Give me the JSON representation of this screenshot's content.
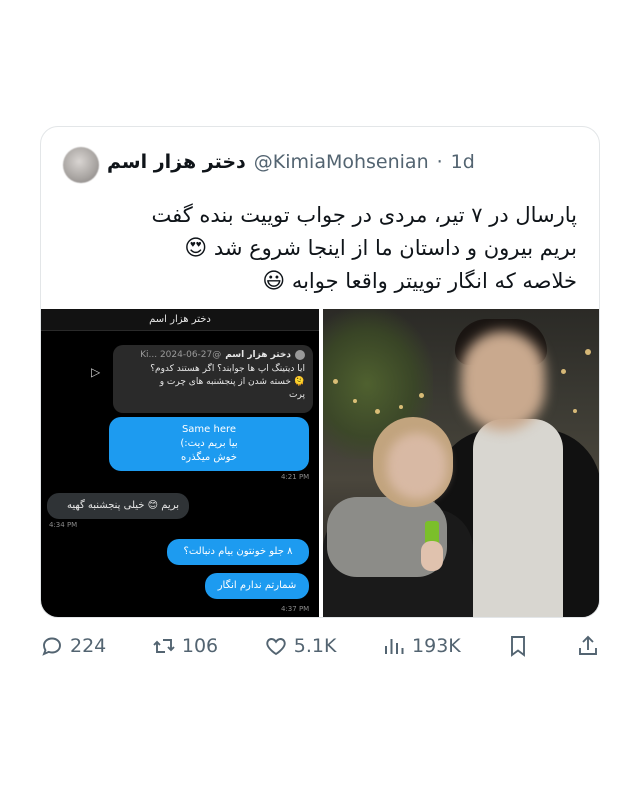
{
  "tweet": {
    "display_name": "دختر هزار اسم",
    "handle": "@KimiaMohsenian",
    "separator": "·",
    "time": "1d",
    "lines": [
      "پارسال در ۷ تیر، مردی در جواب توییت بنده گفت",
      "بریم بیرون و داستان ما از اینجا شروع شد",
      "خلاصه که انگار توییتر واقعا جوابه"
    ],
    "line_emojis": [
      "",
      "😍",
      "😃"
    ]
  },
  "dm": {
    "header": "دختر هزار اسم",
    "quote_name": "دختر هزار اسم",
    "quote_handle": "@Ki... 2024-06-27",
    "quote_line1": "ایا دیتینگ اپ ها جوابند؟ اگر هستند کدوم؟",
    "quote_line2": "🫠 خسته شدن از پنجشنبه های چرت و",
    "quote_line3": "پرت",
    "bubble1_line1": "Same here",
    "bubble1_line2": "بیا بریم دیت:)",
    "bubble1_line3": "خوش میگذره",
    "time1": "4:21 PM",
    "bubble2": "بریم 😊 خیلی پنجشنبه گهیه",
    "time2": "4:34 PM",
    "bubble3": "۸ جلو خونتون بیام دنبالت؟",
    "bubble4": "شمارتم ندارم انگار",
    "time3": "4:37 PM"
  },
  "actions": {
    "replies": "224",
    "retweets": "106",
    "likes": "5.1K",
    "views": "193K"
  },
  "icons": [
    "reply-icon",
    "retweet-icon",
    "like-icon",
    "views-icon",
    "bookmark-icon",
    "share-icon"
  ]
}
